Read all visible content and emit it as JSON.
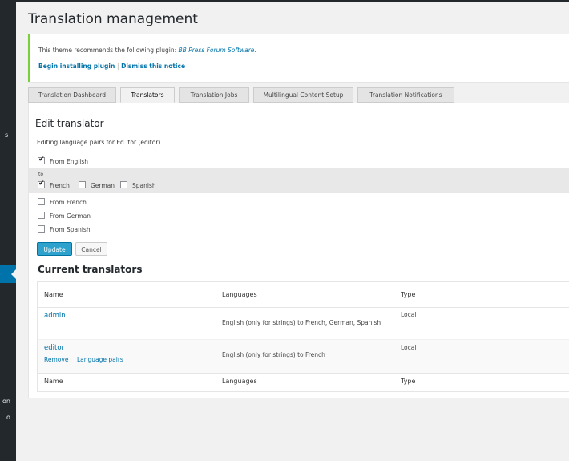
{
  "page": {
    "title": "Translation management"
  },
  "sidebar": {
    "items": [
      "s",
      "on",
      "o"
    ]
  },
  "notice": {
    "text": "This theme recommends the following plugin:",
    "plugin": "BB Press Forum Software.",
    "install_link": "Begin installing plugin",
    "separator": "|",
    "dismiss_link": "Dismiss this notice",
    "accent_color": "#7ad03a"
  },
  "tabs": [
    {
      "label": "Translation Dashboard"
    },
    {
      "label": "Translators"
    },
    {
      "label": "Translation Jobs"
    },
    {
      "label": "Multilingual Content Setup"
    },
    {
      "label": "Translation Notifications"
    }
  ],
  "edit": {
    "title": "Edit translator",
    "subtitle": "Editing language pairs for Ed Itor (editor)",
    "from_english": "From English",
    "to_label": "to",
    "targets": [
      "French",
      "German",
      "Spanish"
    ],
    "from_french": "From French",
    "from_german": "From German",
    "from_spanish": "From Spanish",
    "update_button": "Update",
    "cancel_button": "Cancel"
  },
  "current": {
    "title": "Current translators",
    "columns": [
      "Name",
      "Languages",
      "Type"
    ],
    "rows": [
      {
        "name": "admin",
        "languages": "English (only for strings) to French, German, Spanish",
        "type": "Local"
      },
      {
        "name": "editor",
        "languages": "English (only for strings) to French",
        "type": "Local",
        "remove": "Remove",
        "sep": "|",
        "pairs": "Language pairs"
      }
    ]
  }
}
